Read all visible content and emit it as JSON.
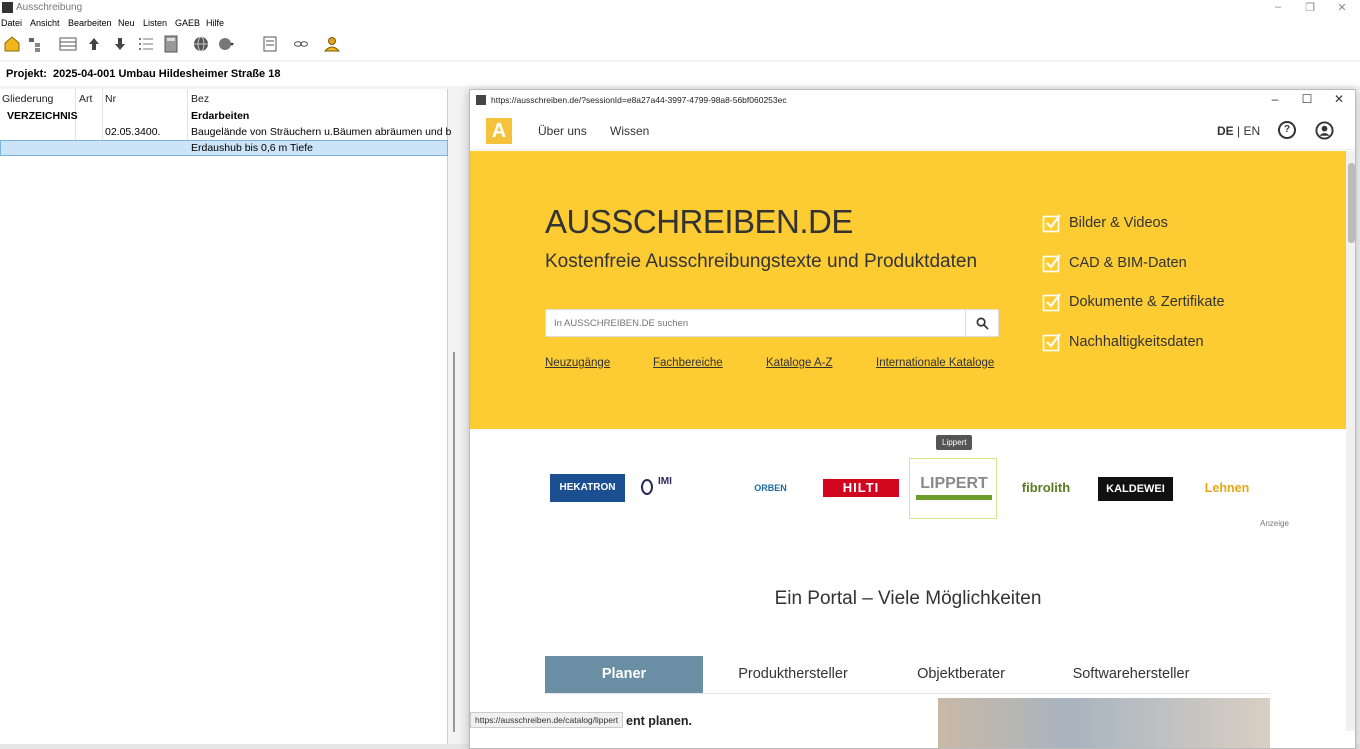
{
  "app": {
    "title": "Ausschreibung",
    "menu": [
      "Datei",
      "Ansicht",
      "Bearbeiten",
      "Neu",
      "Listen",
      "GAEB",
      "Hilfe"
    ],
    "toolbar_icons": [
      "open-project-icon",
      "tree-icon",
      "table-icon",
      "move-up-icon",
      "move-down-icon",
      "numbering-icon",
      "calculator-icon",
      "globe-icon",
      "globe-dropdown-icon",
      "export-icon",
      "link-icon",
      "user-icon"
    ],
    "project_label": "Projekt:",
    "project_value": "2025-04-001 Umbau Hildesheimer Straße 18",
    "grid": {
      "headers": [
        "Gliederung",
        "Art",
        "Nr",
        "Bez"
      ],
      "rows": [
        {
          "gliederung": "VERZEICHNIS",
          "art": "",
          "nr": "",
          "bez": "Erdarbeiten"
        },
        {
          "gliederung": "",
          "art": "",
          "nr": "02.05.3400.",
          "bez": "Baugelände von Sträuchern u.Bäumen abräumen und b"
        },
        {
          "gliederung": "",
          "art": "",
          "nr": "",
          "bez": "Erdaushub bis 0,6 m Tiefe"
        }
      ]
    }
  },
  "popup": {
    "url": "https://ausschreiben.de/?sessionId=e8a27a44-3997-4799-98a8-56bf060253ec",
    "nav": {
      "logo_letter": "A",
      "links": [
        "Über uns",
        "Wissen"
      ],
      "lang_active": "DE",
      "lang_sep": "|",
      "lang_other": "EN",
      "help_glyph": "?"
    },
    "hero": {
      "title_main": "AUSSCHREIBEN",
      "title_tld": ".DE",
      "subtitle": "Kostenfreie Ausschreibungstexte und Produktdaten",
      "search_placeholder": "In AUSSCHREIBEN.DE suchen",
      "links": [
        "Neuzugänge",
        "Fachbereiche",
        "Kataloge A-Z",
        "Internationale Kataloge"
      ],
      "features": [
        "Bilder & Videos",
        "CAD & BIM-Daten",
        "Dokumente & Zertifikate",
        "Nachhaltigkeitsdaten"
      ],
      "accent": "#fdcc33"
    },
    "brands": [
      "HEKATRON",
      "IMI",
      "ORBEN",
      "HILTI",
      "LIPPERT",
      "fibrolith",
      "KALDEWEI",
      "Lehnen"
    ],
    "tooltip": "Lippert",
    "ad_label": "Anzeige",
    "portal_title": "Ein Portal – Viele Möglichkeiten",
    "tabs": [
      "Planer",
      "Produkthersteller",
      "Objektberater",
      "Softwarehersteller"
    ],
    "status_url": "https://ausschreiben.de/catalog/lippert",
    "promo_text": "ent planen."
  }
}
